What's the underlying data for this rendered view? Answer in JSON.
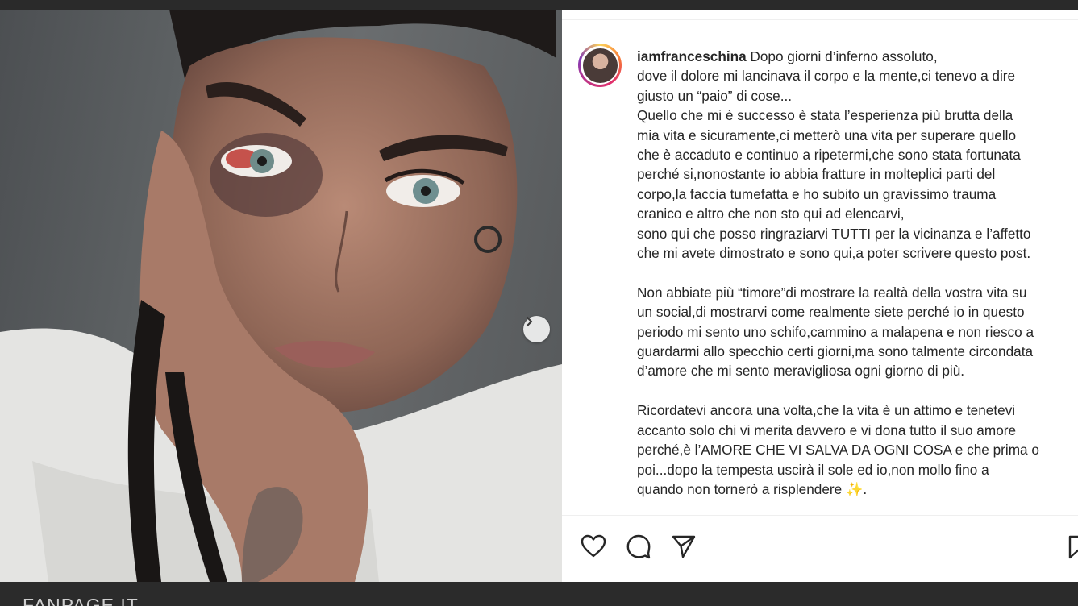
{
  "post": {
    "username": "iamfranceschina",
    "caption_lines": [
      " Dopo giorni d’inferno assoluto,",
      "dove il dolore mi lancinava il corpo e la mente,ci tenevo a dire",
      "giusto un “paio” di cose...",
      "Quello che mi è successo è stata l’esperienza più brutta della",
      "mia vita e sicuramente,ci metterò una vita per superare quello",
      "che è accaduto e continuo a ripetermi,che sono stata fortunata",
      "perché si,nonostante io abbia fratture in molteplici parti del",
      "corpo,la faccia tumefatta e ho subito un gravissimo trauma",
      "cranico e altro che non sto qui ad elencarvi,",
      "sono qui che posso ringraziarvi TUTTI per la vicinanza e l’affetto",
      "che mi avete dimostrato e sono qui,a poter scrivere questo post."
    ],
    "paragraph_2": [
      "Non abbiate più “timore”di mostrare la realtà della vostra vita su",
      "un social,di mostrarvi come realmente siete perché io in questo",
      "periodo mi sento uno schifo,cammino a malapena e non riesco a",
      "guardarmi allo specchio certi giorni,ma sono talmente circondata",
      "d’amore che mi sento meravigliosa ogni giorno di più."
    ],
    "paragraph_3": [
      "Ricordatevi ancora una volta,che la vita è un attimo e tenetevi",
      "accanto solo chi vi merita davvero e vi dona tutto il suo amore",
      "perché,è l’AMORE CHE VI SALVA DA OGNI COSA e che prima o",
      "poi...dopo la tempesta uscirà il sole ed io,non mollo fino a",
      "quando non tornerò a risplendere ✨."
    ]
  },
  "icons": {
    "like": "heart-icon",
    "comment": "comment-icon",
    "share": "paper-plane-icon",
    "save": "bookmark-icon",
    "next": "chevron-right-icon"
  },
  "watermark": "FANPAGE.IT",
  "colors": {
    "text": "#262626",
    "panel_bg": "#ffffff",
    "frame_bg": "#2b2b2b"
  }
}
